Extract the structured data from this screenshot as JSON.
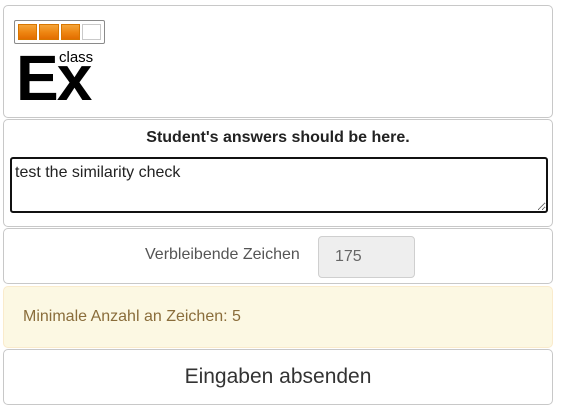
{
  "logo": {
    "main_text": "Ex",
    "small_text": "class",
    "progress_segments": [
      true,
      true,
      true,
      false
    ]
  },
  "answer": {
    "label": "Student's answers should be here.",
    "value": "test the similarity check"
  },
  "remaining": {
    "label": "Verbleibende Zeichen",
    "count": "175"
  },
  "notice": {
    "text": "Minimale Anzahl an Zeichen: 5"
  },
  "submit": {
    "label": "Eingaben absenden"
  },
  "colors": {
    "logo_orange": "#ee8410",
    "notice_background": "#fcf8e3",
    "notice_text": "#8a6d3b"
  }
}
